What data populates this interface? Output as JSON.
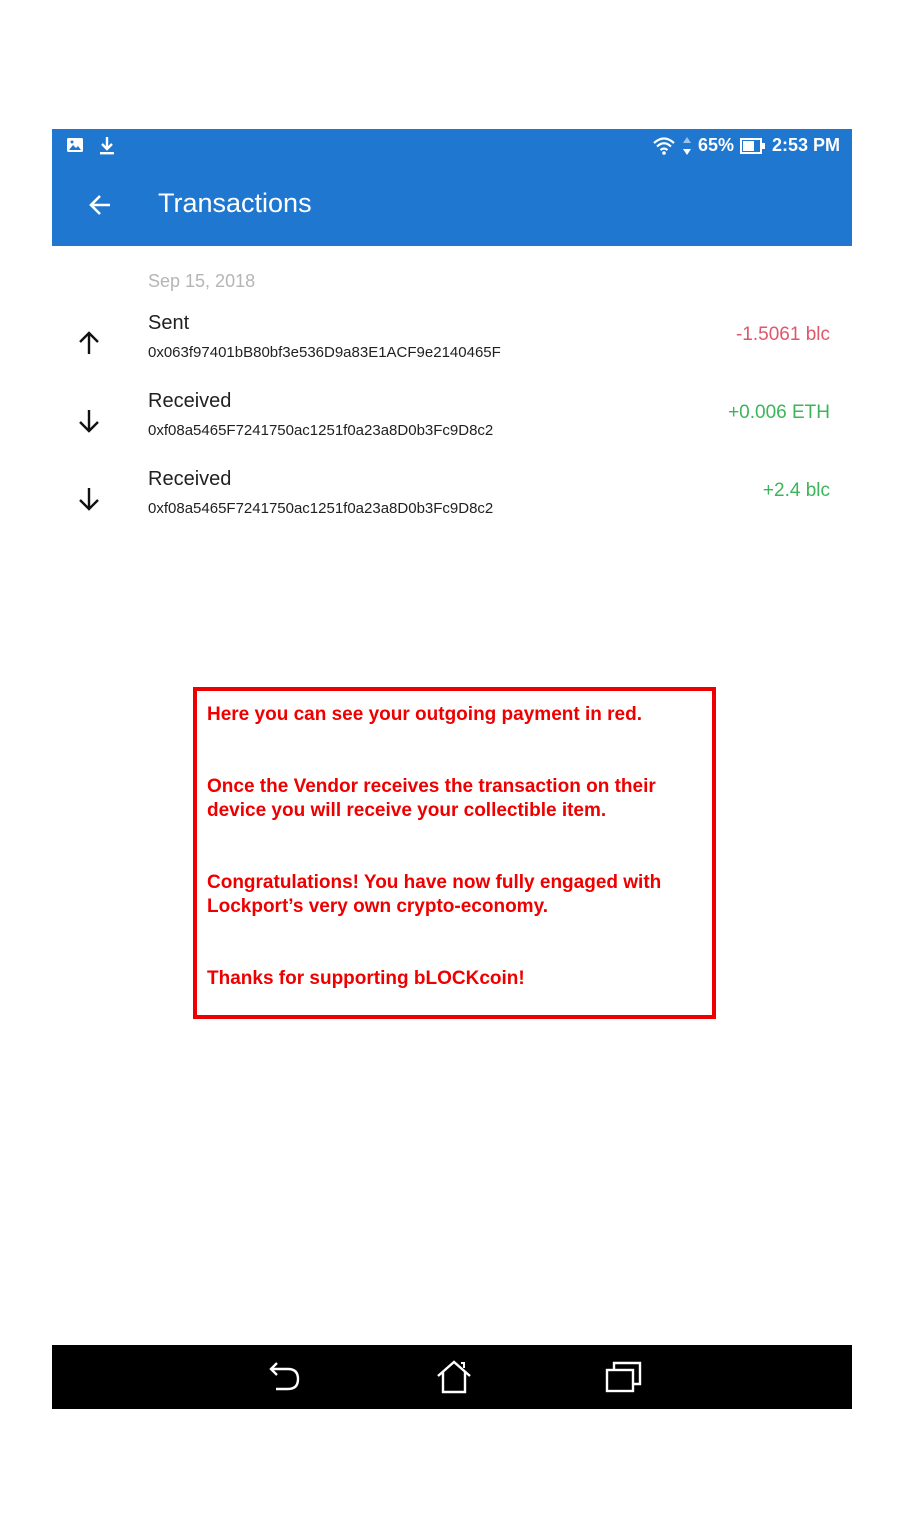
{
  "status_bar": {
    "battery": "65%",
    "time": "2:53 PM"
  },
  "app_bar": {
    "title": "Transactions"
  },
  "date_header": "Sep 15, 2018",
  "transactions": [
    {
      "type": "Sent",
      "address": "0x063f97401bB80bf3e536D9a83E1ACF9e2140465F",
      "amount": "-1.5061 blc",
      "direction": "up"
    },
    {
      "type": "Received",
      "address": "0xf08a5465F7241750ac1251f0a23a8D0b3Fc9D8c2",
      "amount": "+0.006 ETH",
      "direction": "down"
    },
    {
      "type": "Received",
      "address": "0xf08a5465F7241750ac1251f0a23a8D0b3Fc9D8c2",
      "amount": "+2.4 blc",
      "direction": "down"
    }
  ],
  "callout": {
    "line1": "Here you can see your outgoing payment in red.",
    "line2": "Once the Vendor receives the transaction on their device you will receive your collectible item.",
    "line3": "Congratulations!  You have now fully engaged with Lockport’s very own crypto-economy.",
    "line4": "Thanks for supporting bLOCKcoin!"
  },
  "colors": {
    "primary": "#1f77d0",
    "negative": "#e0566b",
    "positive": "#3cb55a",
    "callout": "#ee0000"
  }
}
